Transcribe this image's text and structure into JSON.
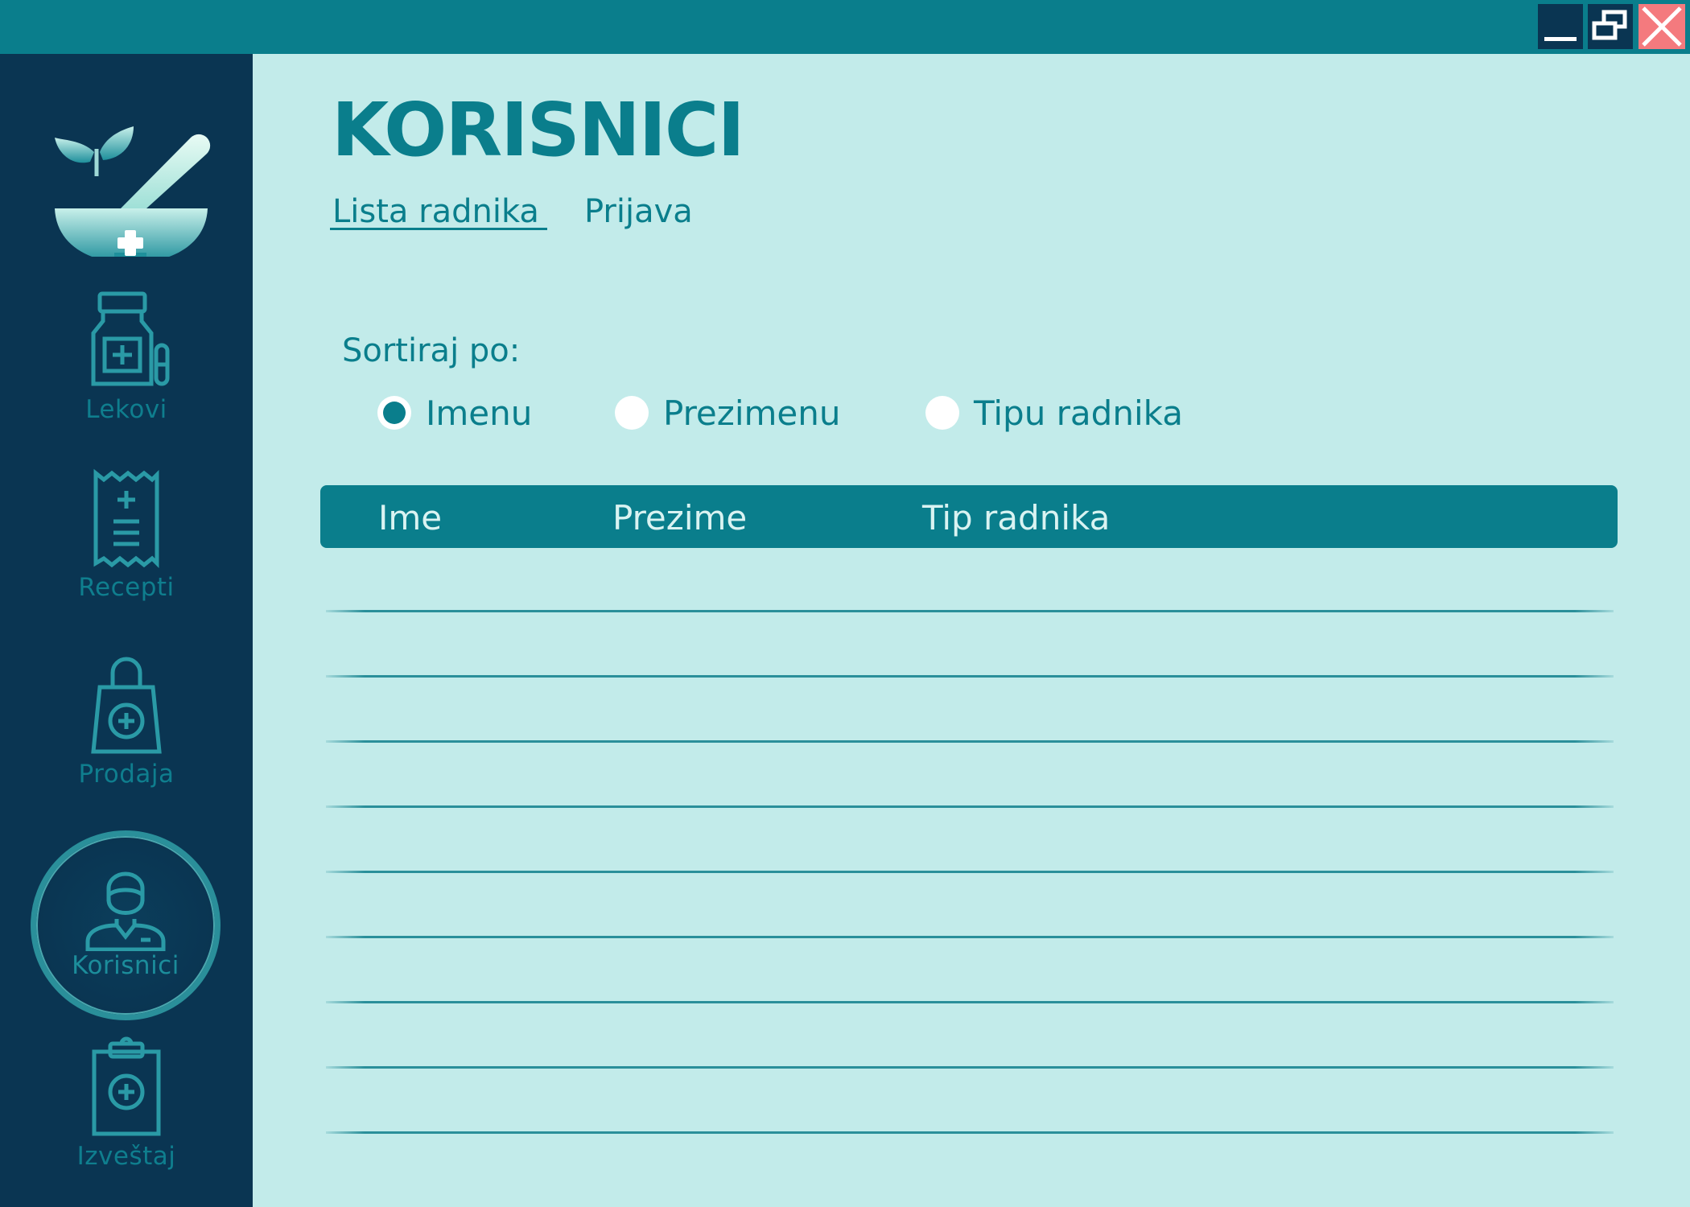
{
  "window": {
    "controls": [
      "minimize-icon",
      "restore-icon",
      "close-icon"
    ],
    "colors": {
      "titlebar": "#0a7e8c",
      "close": "#f47a7e",
      "sidebar": "#0a3552",
      "background": "#c2ebea"
    }
  },
  "sidebar": {
    "logo_icon": "mortar-pestle-icon",
    "items": [
      {
        "label": "Lekovi",
        "icon": "medicine-bottle-icon",
        "active": false
      },
      {
        "label": "Recepti",
        "icon": "receipt-icon",
        "active": false
      },
      {
        "label": "Prodaja",
        "icon": "shopping-bag-icon",
        "active": false
      },
      {
        "label": "Korisnici",
        "icon": "user-icon",
        "active": true
      },
      {
        "label": "Izveštaj",
        "icon": "clipboard-icon",
        "active": false
      }
    ]
  },
  "main": {
    "title": "KORISNICI",
    "tabs": [
      {
        "label": "Lista radnika",
        "active": true
      },
      {
        "label": "Prijava",
        "active": false
      }
    ],
    "sort": {
      "label": "Sortiraj po:",
      "options": [
        {
          "label": "Imenu",
          "selected": true
        },
        {
          "label": "Prezimenu",
          "selected": false
        },
        {
          "label": "Tipu radnika",
          "selected": false
        }
      ]
    },
    "table": {
      "columns": [
        "Ime",
        "Prezime",
        "Tip radnika"
      ],
      "rows": []
    }
  }
}
